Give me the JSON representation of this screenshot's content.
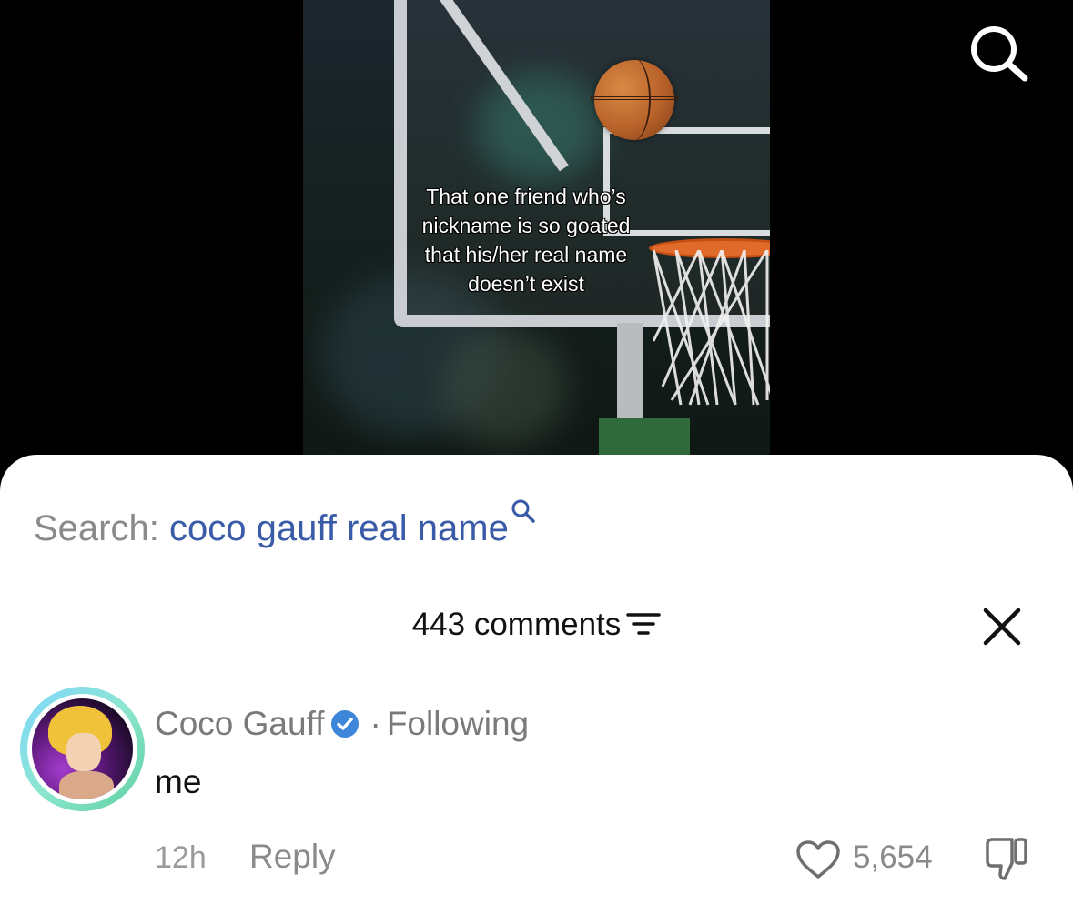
{
  "video": {
    "caption_lines": [
      "That one friend who’s",
      "nickname is so goated",
      "that his/her real name",
      "doesn’t exist"
    ]
  },
  "search": {
    "prefix": "Search:",
    "query": "coco gauff real name"
  },
  "comments": {
    "count_label": "443 comments",
    "items": [
      {
        "username": "Coco Gauff",
        "following_label": "Following",
        "text": "me",
        "time": "12h",
        "reply_label": "Reply",
        "likes": "5,654"
      }
    ]
  },
  "icons": {
    "search_top": "search-icon",
    "search_inline": "search-icon",
    "filter": "filter-icon",
    "close": "close-icon",
    "verified": "verified-badge-icon",
    "like": "heart-icon",
    "dislike": "thumbs-down-icon"
  },
  "colors": {
    "search_query": "#3a5ba8",
    "verified_badge": "#3d86d9",
    "muted_text": "#8a8a8a",
    "avatar_ring": "#7fd7ff"
  }
}
